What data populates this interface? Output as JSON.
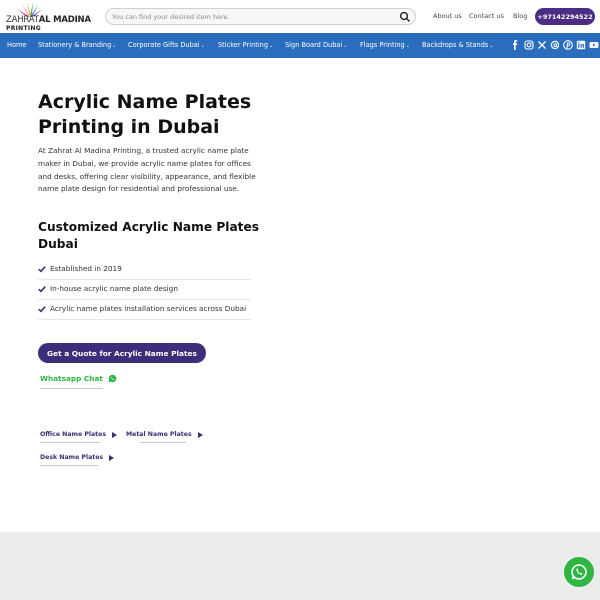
{
  "header": {
    "logo": {
      "word1": "ZAHRAT",
      "word2": "AL MADINA",
      "word3": "PRINTING"
    },
    "search": {
      "placeholder": "You can find your desired item here."
    },
    "links": [
      "About us",
      "Contact us",
      "Blog"
    ],
    "phone": "+97142294522"
  },
  "nav": {
    "items": [
      {
        "label": "Home",
        "dropdown": false
      },
      {
        "label": "Stationery & Branding",
        "dropdown": true
      },
      {
        "label": "Corporate Gifts Dubai",
        "dropdown": true
      },
      {
        "label": "Sticker Printing",
        "dropdown": true
      },
      {
        "label": "Sign Board Dubai",
        "dropdown": true
      },
      {
        "label": "Flags Printing",
        "dropdown": true
      },
      {
        "label": "Backdrops & Stands",
        "dropdown": true
      }
    ],
    "social_icons": [
      "facebook-icon",
      "instagram-icon",
      "x-icon",
      "threads-icon",
      "pinterest-icon",
      "linkedin-icon",
      "youtube-icon"
    ]
  },
  "main": {
    "title": "Acrylic Name Plates Printing in Dubai",
    "intro": "At Zahrat Al Madina Printing, a trusted acrylic name plate maker in Dubai, we provide acrylic name plates for offices and desks, offering clear visibility, appearance, and flexible name plate design for residential and professional use.",
    "subtitle": "Customized Acrylic Name Plates Dubai",
    "checklist": [
      "Established in 2019",
      "In-house acrylic name plate design",
      "Acrylic name plates installation services across Dubai"
    ],
    "quote_button": "Get a Quote for Acrylic Name Plates",
    "whatsapp_label": "Whatsapp Chat",
    "sublinks": [
      "Office Name Plates",
      "Metal Name Plates",
      "Desk Name Plates"
    ]
  },
  "colors": {
    "nav_blue": "#2b6dbd",
    "brand_purple": "#3d2d7a",
    "whatsapp_green": "#2db742",
    "footer_gray": "#ececec"
  }
}
